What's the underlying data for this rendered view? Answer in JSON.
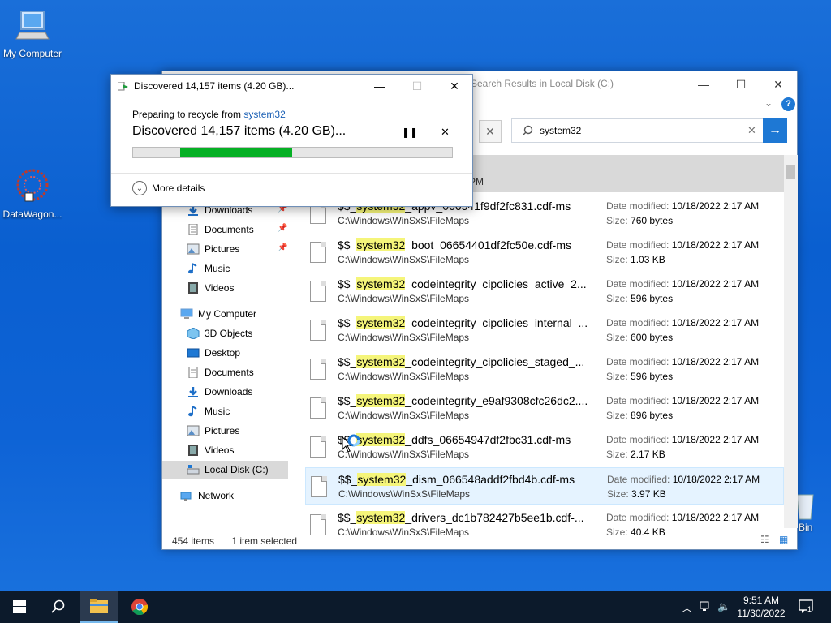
{
  "desktop": {
    "icons": [
      {
        "label": "My Computer"
      },
      {
        "label": "DataWagon..."
      },
      {
        "label": "e Bin"
      }
    ]
  },
  "explorer": {
    "title": "Search Results in Local Disk (C:)",
    "search_value": "system32",
    "column_header": "PM",
    "nav": {
      "quick_access": [
        {
          "label": "Downloads"
        },
        {
          "label": "Documents"
        },
        {
          "label": "Pictures"
        },
        {
          "label": "Music"
        },
        {
          "label": "Videos"
        }
      ],
      "my_computer": "My Computer",
      "my_computer_items": [
        {
          "label": "3D Objects"
        },
        {
          "label": "Desktop"
        },
        {
          "label": "Documents"
        },
        {
          "label": "Downloads"
        },
        {
          "label": "Music"
        },
        {
          "label": "Pictures"
        },
        {
          "label": "Videos"
        },
        {
          "label": "Local Disk (C:)"
        }
      ],
      "network": "Network"
    },
    "files": [
      {
        "pre": "$$_",
        "hl": "system32",
        "post": "_appv_066541f9df2fc831.cdf-ms",
        "path": "C:\\Windows\\WinSxS\\FileMaps",
        "date": "10/18/2022 2:17 AM",
        "size": "760 bytes"
      },
      {
        "pre": "$$_",
        "hl": "system32",
        "post": "_boot_06654401df2fc50e.cdf-ms",
        "path": "C:\\Windows\\WinSxS\\FileMaps",
        "date": "10/18/2022 2:17 AM",
        "size": "1.03 KB"
      },
      {
        "pre": "$$_",
        "hl": "system32",
        "post": "_codeintegrity_cipolicies_active_2...",
        "path": "C:\\Windows\\WinSxS\\FileMaps",
        "date": "10/18/2022 2:17 AM",
        "size": "596 bytes"
      },
      {
        "pre": "$$_",
        "hl": "system32",
        "post": "_codeintegrity_cipolicies_internal_...",
        "path": "C:\\Windows\\WinSxS\\FileMaps",
        "date": "10/18/2022 2:17 AM",
        "size": "600 bytes"
      },
      {
        "pre": "$$_",
        "hl": "system32",
        "post": "_codeintegrity_cipolicies_staged_...",
        "path": "C:\\Windows\\WinSxS\\FileMaps",
        "date": "10/18/2022 2:17 AM",
        "size": "596 bytes"
      },
      {
        "pre": "$$_",
        "hl": "system32",
        "post": "_codeintegrity_e9af9308cfc26dc2....",
        "path": "C:\\Windows\\WinSxS\\FileMaps",
        "date": "10/18/2022 2:17 AM",
        "size": "896 bytes"
      },
      {
        "pre": "$$_",
        "hl": "system32",
        "post": "_ddfs_06654947df2fbc31.cdf-ms",
        "path": "C:\\Windows\\WinSxS\\FileMaps",
        "date": "10/18/2022 2:17 AM",
        "size": "2.17 KB"
      },
      {
        "pre": "$$_",
        "hl": "system32",
        "post": "_dism_066548addf2fbd4b.cdf-ms",
        "path": "C:\\Windows\\WinSxS\\FileMaps",
        "date": "10/18/2022 2:17 AM",
        "size": "3.97 KB"
      },
      {
        "pre": "$$_",
        "hl": "system32",
        "post": "_drivers_dc1b782427b5ee1b.cdf-...",
        "path": "C:\\Windows\\WinSxS\\FileMaps",
        "date": "10/18/2022 2:17 AM",
        "size": "40.4 KB"
      }
    ],
    "date_label": "Date modified:",
    "size_label": "Size:",
    "status_count": "454 items",
    "status_selected": "1 item selected"
  },
  "dialog": {
    "title": "Discovered 14,157 items (4.20 GB)...",
    "preparing_text": "Preparing to recycle from",
    "source": "system32",
    "discovered": "Discovered 14,157 items (4.20 GB)...",
    "progress": 0.35,
    "more_details": "More details"
  },
  "taskbar": {
    "time": "9:51 AM",
    "date": "11/30/2022",
    "notifications": "1"
  }
}
